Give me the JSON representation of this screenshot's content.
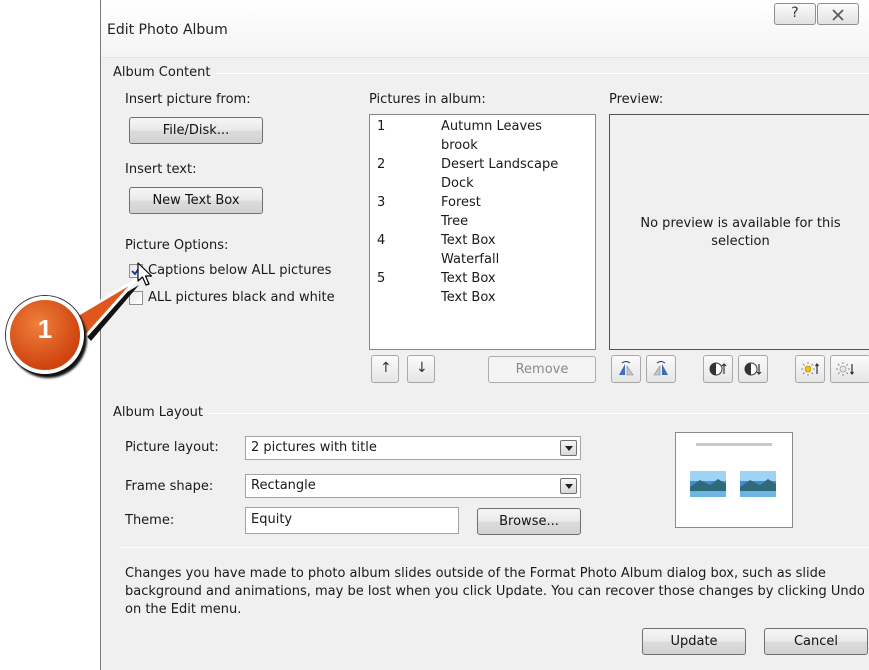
{
  "dialog": {
    "title": "Edit Photo Album",
    "help_glyph": "?",
    "close_glyph": "X"
  },
  "album_content": {
    "group_label": "Album Content",
    "insert_picture_label": "Insert picture from:",
    "file_disk_button": "File/Disk...",
    "insert_text_label": "Insert text:",
    "new_text_box_button": "New Text Box",
    "picture_options_label": "Picture Options:",
    "captions_checkbox": {
      "label": "Captions below ALL pictures",
      "checked": true
    },
    "bw_checkbox": {
      "label": "ALL pictures black and white",
      "checked": false
    },
    "pictures_label": "Pictures in album:",
    "pictures": [
      {
        "num": "1",
        "name": "Autumn Leaves"
      },
      {
        "num": "",
        "name": "brook"
      },
      {
        "num": "2",
        "name": "Desert Landscape"
      },
      {
        "num": "",
        "name": "Dock"
      },
      {
        "num": "3",
        "name": "Forest"
      },
      {
        "num": "",
        "name": "Tree"
      },
      {
        "num": "4",
        "name": "Text Box"
      },
      {
        "num": "",
        "name": "Waterfall"
      },
      {
        "num": "5",
        "name": "Text Box"
      },
      {
        "num": "",
        "name": "Text Box"
      }
    ],
    "move_up_glyph": "↑",
    "move_down_glyph": "↓",
    "remove_button": "Remove",
    "preview_label": "Preview:",
    "preview_message": "No preview is available for this selection"
  },
  "album_layout": {
    "group_label": "Album Layout",
    "picture_layout_label": "Picture layout:",
    "picture_layout_value": "2 pictures with title",
    "frame_shape_label": "Frame shape:",
    "frame_shape_value": "Rectangle",
    "theme_label": "Theme:",
    "theme_value": "Equity",
    "browse_button": "Browse..."
  },
  "info_text": "Changes you have made to photo album slides outside of the Format Photo Album dialog box, such as slide background and animations, may be lost when you click Update. You can recover those changes by clicking Undo on the Edit menu.",
  "footer": {
    "update_button": "Update",
    "cancel_button": "Cancel"
  },
  "callout": {
    "number": "1",
    "color": "#e0561c"
  },
  "icons": {
    "help": "help-icon",
    "close": "close-icon",
    "rotate_left": "rotate-left-icon",
    "rotate_right": "rotate-right-icon",
    "contrast_up": "contrast-increase-icon",
    "contrast_down": "contrast-decrease-icon",
    "brightness_up": "brightness-increase-icon",
    "brightness_down": "brightness-decrease-icon"
  }
}
